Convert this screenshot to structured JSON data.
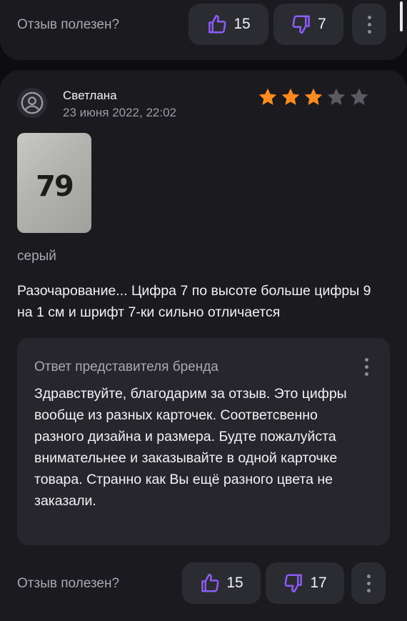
{
  "top_review": {
    "helpful_label": "Отзыв полезен?",
    "likes": "15",
    "dislikes": "7"
  },
  "review": {
    "author": "Светлана",
    "date": "23 июня 2022, 22:02",
    "rating": 3,
    "rating_max": 5,
    "photo_text": "79",
    "variant": "серый",
    "text": "Разочарование... Цифра 7 по высоте больше цифры 9 на 1 см и шрифт 7-ки сильно отличается",
    "brand_reply": {
      "title": "Ответ представителя бренда",
      "text": "Здравствуйте, благодарим за отзыв. Это цифры вообще из разных карточек. Соответсвенно разного дизайна и размера. Будте пожалуйста внимательнее и заказывайте в одной карточке товара. Странно как Вы ещё разного цвета не заказали."
    },
    "helpful_label": "Отзыв полезен?",
    "likes": "15",
    "dislikes": "17"
  },
  "colors": {
    "accent": "#8b5cf6",
    "star_filled": "#ff8a1f",
    "star_empty": "#5a5a62",
    "card_bg": "#1b1b1f",
    "button_bg": "#2b2b32"
  },
  "icons": {
    "like": "thumbs-up-icon",
    "dislike": "thumbs-down-icon",
    "more": "more-vertical-icon",
    "avatar": "user-avatar-icon",
    "star": "star-icon"
  }
}
